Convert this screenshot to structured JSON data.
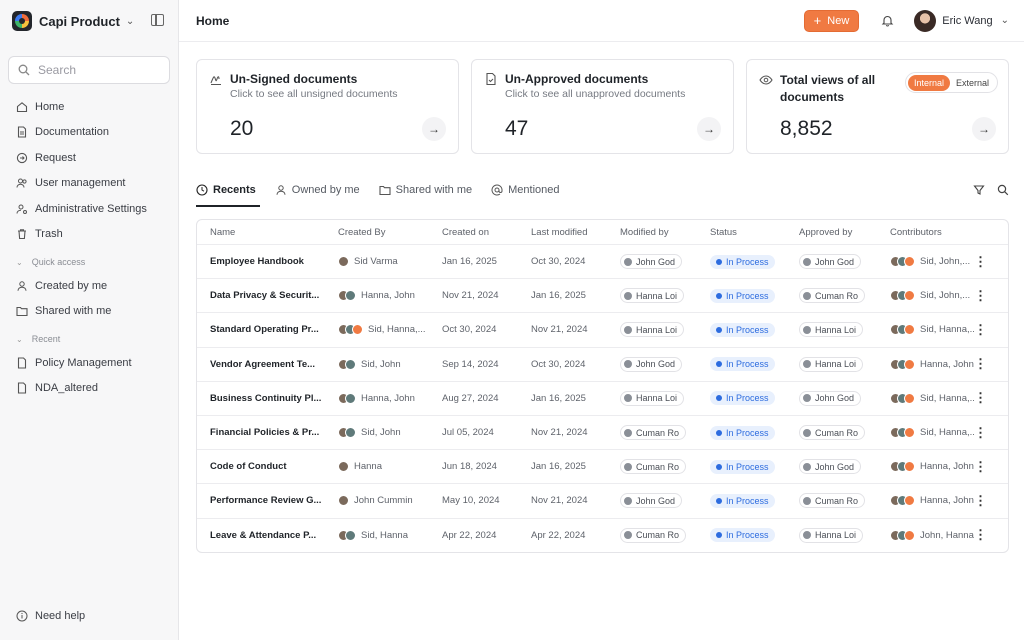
{
  "app": {
    "name": "Capi Product"
  },
  "search": {
    "placeholder": "Search"
  },
  "nav": {
    "items": [
      {
        "label": "Home",
        "icon": "home-icon"
      },
      {
        "label": "Documentation",
        "icon": "document-icon"
      },
      {
        "label": "Request",
        "icon": "request-icon"
      },
      {
        "label": "User management",
        "icon": "users-icon"
      },
      {
        "label": "Administrative Settings",
        "icon": "admin-settings-icon"
      },
      {
        "label": "Trash",
        "icon": "trash-icon"
      }
    ],
    "quick_access": {
      "title": "Quick access",
      "items": [
        {
          "label": "Created by me",
          "icon": "user-icon"
        },
        {
          "label": "Shared with me",
          "icon": "shared-folder-icon"
        }
      ]
    },
    "recent": {
      "title": "Recent",
      "items": [
        {
          "label": "Policy Management",
          "icon": "document-icon"
        },
        {
          "label": "NDA_altered",
          "icon": "document-icon"
        }
      ]
    },
    "help": "Need help"
  },
  "header": {
    "title": "Home",
    "new_label": "New",
    "user_name": "Eric Wang"
  },
  "cards": [
    {
      "title": "Un-Signed documents",
      "subtitle": "Click to see all unsigned documents",
      "value": "20"
    },
    {
      "title": "Un-Approved documents",
      "subtitle": "Click to see all unapproved documents",
      "value": "47"
    },
    {
      "title": "Total views of all documents",
      "value": "8,852",
      "toggle": [
        "Internal",
        "External"
      ],
      "toggle_active": "Internal"
    }
  ],
  "tabs": [
    "Recents",
    "Owned by me",
    "Shared with me",
    "Mentioned"
  ],
  "table": {
    "columns": [
      "Name",
      "Created By",
      "Created on",
      "Last modified",
      "Modified by",
      "Status",
      "Approved by",
      "Contributors"
    ],
    "rows": [
      {
        "name": "Employee Handbook",
        "created_by": "Sid Varma",
        "created_on": "Jan 16, 2025",
        "last_modified": "Oct 30, 2024",
        "modified_by": "John God",
        "status": "In Process",
        "approved_by": "John God",
        "contributors": "Sid, John,..."
      },
      {
        "name": "Data Privacy & Securit...",
        "created_by": "Hanna, John",
        "created_on": "Nov 21, 2024",
        "last_modified": "Jan 16, 2025",
        "modified_by": "Hanna Loi",
        "status": "In Process",
        "approved_by": "Cuman Ro",
        "contributors": "Sid, John,..."
      },
      {
        "name": "Standard Operating Pr...",
        "created_by": "Sid, Hanna,...",
        "created_on": "Oct 30, 2024",
        "last_modified": "Nov 21, 2024",
        "modified_by": "Hanna Loi",
        "status": "In Process",
        "approved_by": "Hanna Loi",
        "contributors": "Sid, Hanna,..."
      },
      {
        "name": "Vendor Agreement Te...",
        "created_by": "Sid, John",
        "created_on": "Sep 14, 2024",
        "last_modified": "Oct 30, 2024",
        "modified_by": "John God",
        "status": "In Process",
        "approved_by": "Hanna Loi",
        "contributors": "Hanna, John,..."
      },
      {
        "name": "Business Continuity Pl...",
        "created_by": "Hanna, John",
        "created_on": "Aug 27, 2024",
        "last_modified": "Jan 16, 2025",
        "modified_by": "Hanna Loi",
        "status": "In Process",
        "approved_by": "John God",
        "contributors": "Sid, Hanna,..."
      },
      {
        "name": "Financial Policies & Pr...",
        "created_by": "Sid, John",
        "created_on": "Jul 05, 2024",
        "last_modified": "Nov 21, 2024",
        "modified_by": "Cuman Ro",
        "status": "In Process",
        "approved_by": "Cuman Ro",
        "contributors": "Sid, Hanna,..."
      },
      {
        "name": "Code of Conduct",
        "created_by": "Hanna",
        "created_on": "Jun 18, 2024",
        "last_modified": "Jan 16, 2025",
        "modified_by": "Cuman Ro",
        "status": "In Process",
        "approved_by": "John God",
        "contributors": "Hanna, John,..."
      },
      {
        "name": "Performance Review G...",
        "created_by": "John Cummin",
        "created_on": "May 10, 2024",
        "last_modified": "Nov 21, 2024",
        "modified_by": "John God",
        "status": "In Process",
        "approved_by": "Cuman Ro",
        "contributors": "Hanna, John,..."
      },
      {
        "name": "Leave & Attendance P...",
        "created_by": "Sid, Hanna",
        "created_on": "Apr 22, 2024",
        "last_modified": "Apr 22, 2024",
        "modified_by": "Cuman Ro",
        "status": "In Process",
        "approved_by": "Hanna Loi",
        "contributors": "John, Hanna,..."
      }
    ]
  },
  "colors": {
    "accent": "#f07a42",
    "status_blue": "#2d6cdf"
  }
}
